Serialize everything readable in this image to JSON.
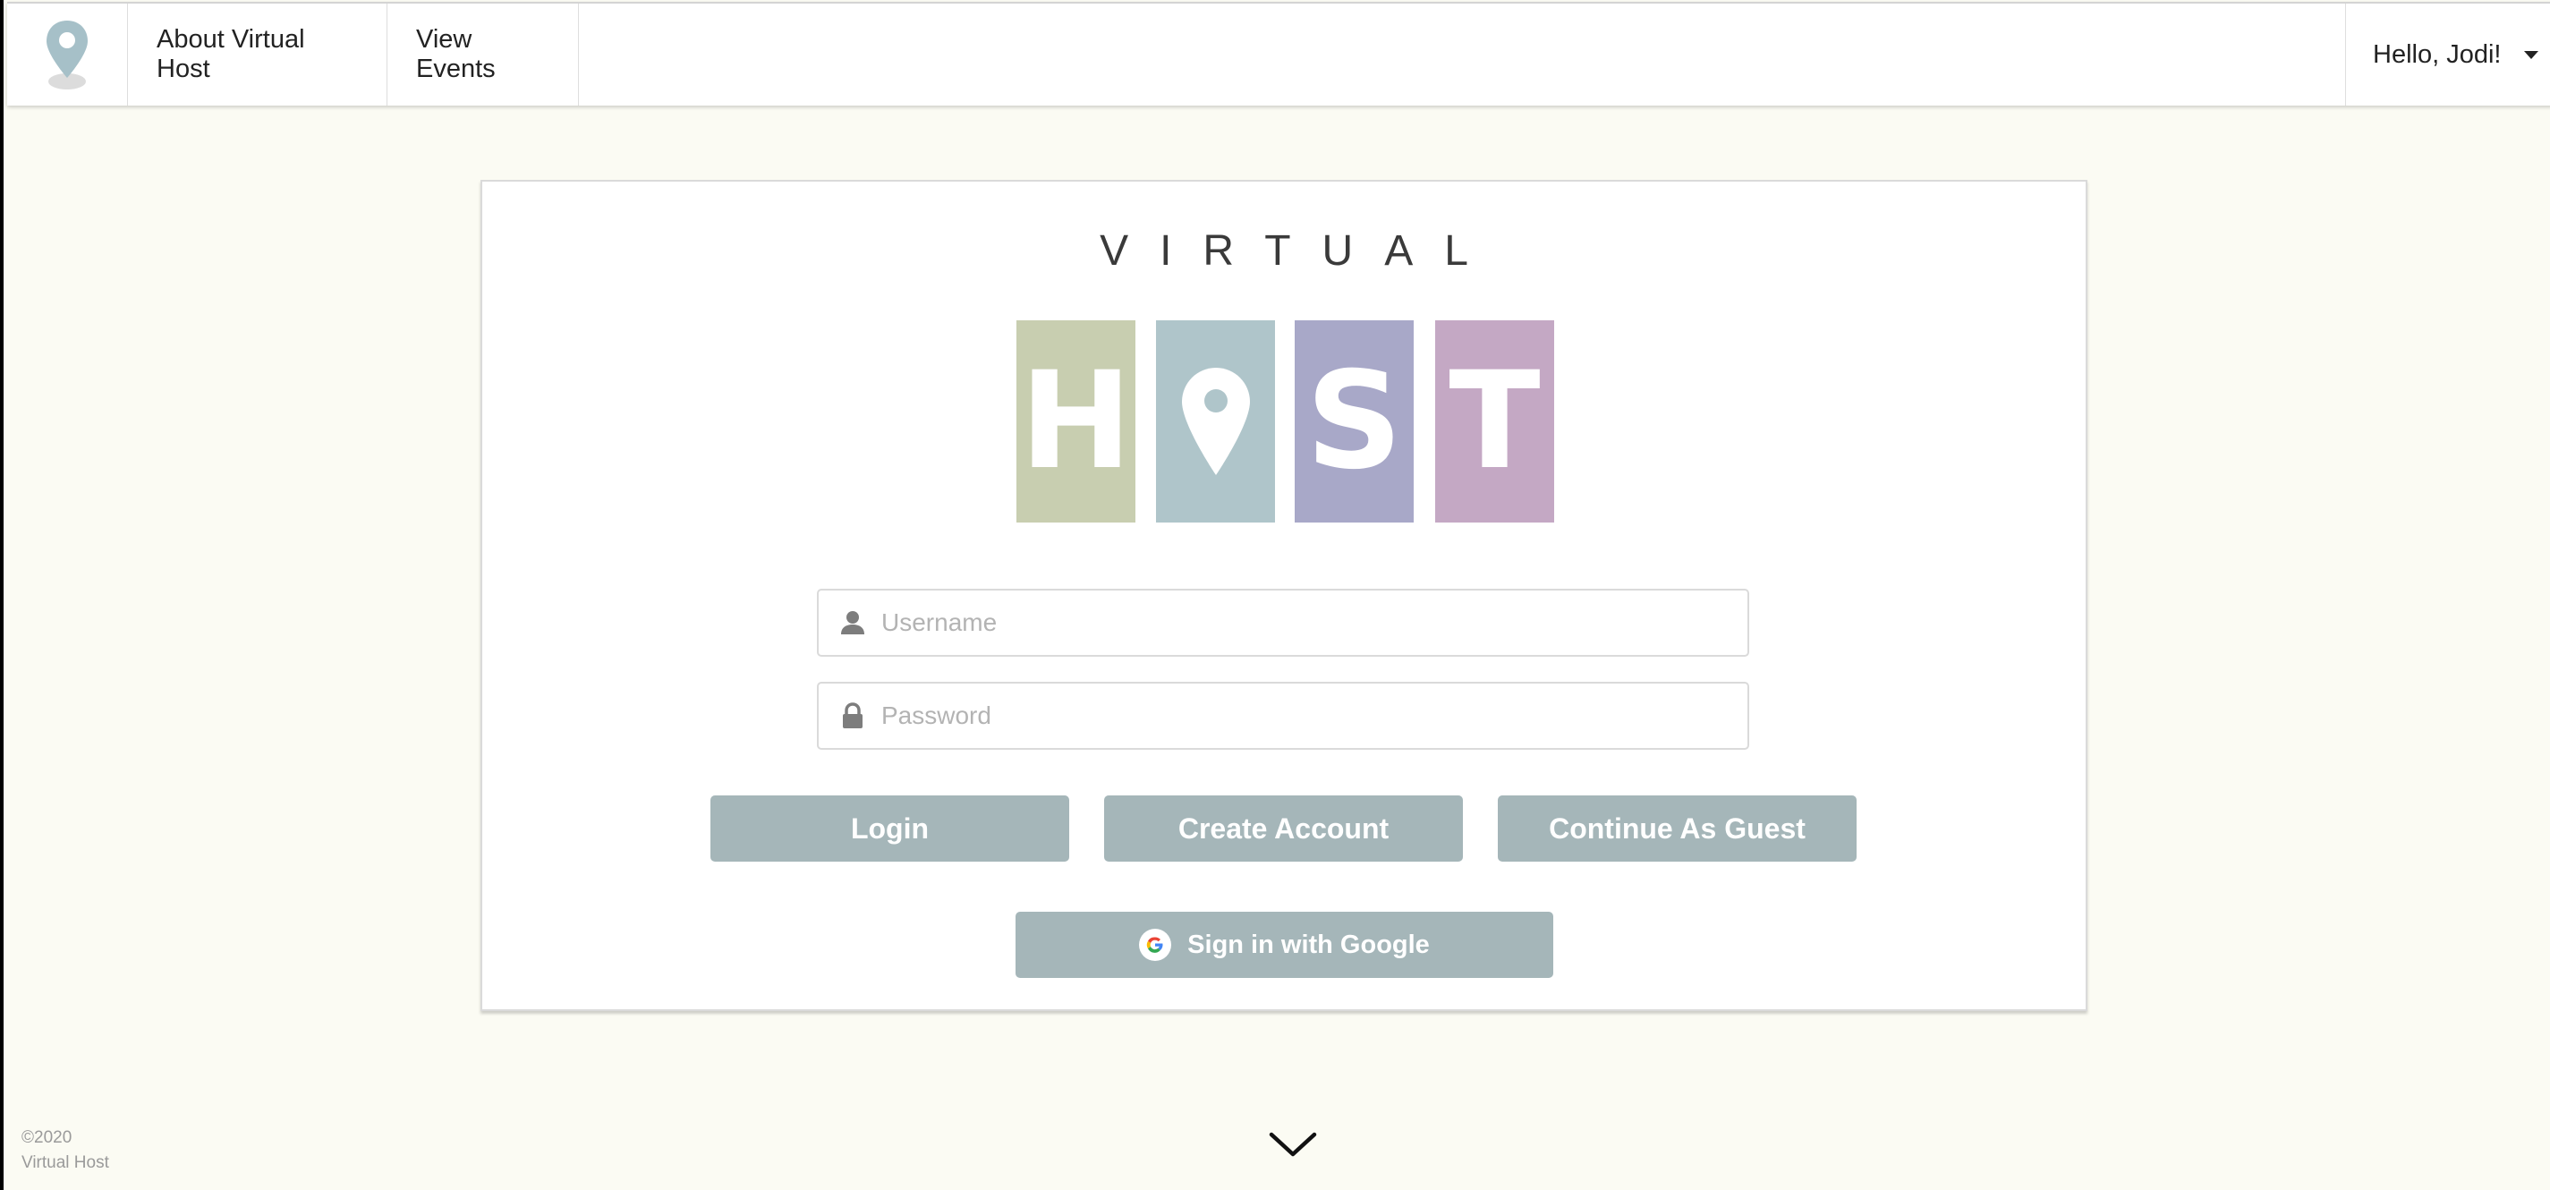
{
  "nav": {
    "logo_icon": "map-pin-icon",
    "about_label": "About Virtual Host",
    "events_label": "View Events",
    "user_greeting": "Hello, Jodi!"
  },
  "brand": {
    "top_word": "VIRTUAL",
    "tiles": [
      {
        "letter": "H",
        "color": "#c8ceb0"
      },
      {
        "letter": "",
        "icon": "map-pin-icon",
        "color": "#afc5ca"
      },
      {
        "letter": "S",
        "color": "#a8a8c8"
      },
      {
        "letter": "T",
        "color": "#c4a8c4"
      }
    ]
  },
  "form": {
    "username_placeholder": "Username",
    "password_placeholder": "Password",
    "login_label": "Login",
    "create_account_label": "Create Account",
    "guest_label": "Continue As Guest",
    "google_label": "Sign in with Google"
  },
  "footer": {
    "copyright": "©2020",
    "company": "Virtual Host"
  },
  "colors": {
    "background": "#fbfbf3",
    "button": "#a5b6b9",
    "tile_h": "#c8ceb0",
    "tile_o": "#afc5ca",
    "tile_s": "#a8a8c8",
    "tile_t": "#c4a8c4"
  }
}
